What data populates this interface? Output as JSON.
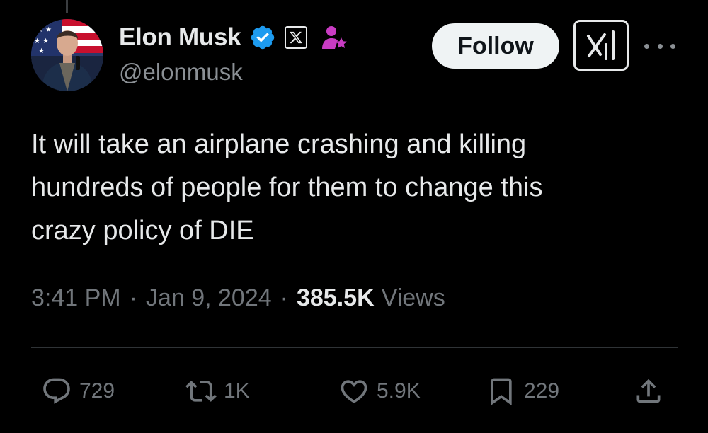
{
  "author": {
    "display_name": "Elon Musk",
    "handle": "@elonmusk",
    "verified_icon": "verified-badge-icon",
    "affiliation_badge_icon": "x-logo-icon",
    "subscription_icon": "person-star-icon"
  },
  "header": {
    "follow_label": "Follow",
    "grok_icon": "grok-icon",
    "more_icon": "more-icon"
  },
  "tweet": {
    "lines": [
      "It will take an airplane crashing and killing",
      "hundreds of people for them to change this",
      "crazy policy of DIE"
    ],
    "time": "3:41 PM",
    "date": "Jan 9, 2024",
    "separator": "·",
    "views_count": "385.5K",
    "views_label": "Views"
  },
  "actions": {
    "replies": "729",
    "reposts": "1K",
    "likes": "5.9K",
    "bookmarks": "229",
    "share_icon": "share-icon"
  },
  "colors": {
    "background": "#000000",
    "text_primary": "#e7e9ea",
    "text_secondary": "#71767b",
    "verified_blue": "#1d9bf0",
    "affiliate_purple": "#c93cc3",
    "divider": "#2f3336"
  }
}
